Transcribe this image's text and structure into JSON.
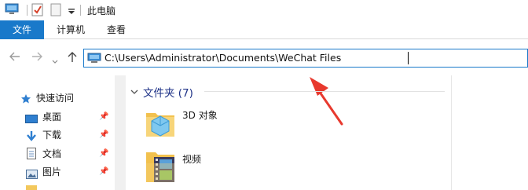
{
  "titlebar": {
    "title": "此电脑"
  },
  "ribbon": {
    "tabs": [
      "文件",
      "计算机",
      "查看"
    ]
  },
  "address": {
    "path": "C:\\Users\\Administrator\\Documents\\WeChat Files"
  },
  "nav_pane": {
    "items": [
      {
        "label": "快速访问",
        "icon": "star-icon",
        "pinned": false
      },
      {
        "label": "桌面",
        "icon": "desktop-folder-icon",
        "pinned": true
      },
      {
        "label": "下载",
        "icon": "download-arrow-icon",
        "pinned": true
      },
      {
        "label": "文档",
        "icon": "document-icon",
        "pinned": true
      },
      {
        "label": "图片",
        "icon": "pictures-icon",
        "pinned": true
      }
    ]
  },
  "content": {
    "group_title": "文件夹 (7)",
    "folders": [
      {
        "label": "3D 对象",
        "icon": "3d-objects-folder-icon"
      },
      {
        "label": "视频",
        "icon": "videos-folder-icon"
      }
    ]
  },
  "colors": {
    "accent": "#1979ca",
    "annotation_arrow": "#e8392e",
    "group_title": "#1e3287"
  }
}
